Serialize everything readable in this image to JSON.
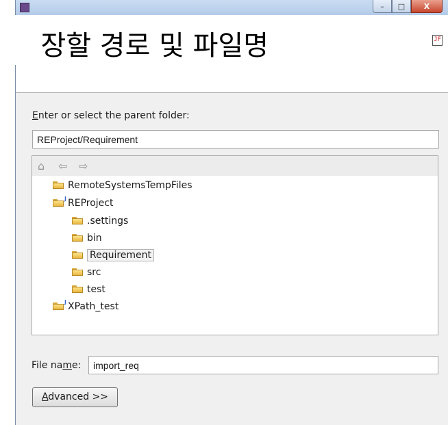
{
  "window": {
    "title": "",
    "controls": {
      "minimize": "–",
      "maximize": "□",
      "close": "X"
    }
  },
  "overlay_title": "장할 경로 및 파일명",
  "parent_folder": {
    "label_first": "E",
    "label_rest": "nter or select the parent folder:",
    "value": "REProject/Requirement"
  },
  "tree": {
    "toolbar_icons": [
      "home-icon",
      "back-arrow-icon",
      "forward-arrow-icon"
    ],
    "nodes": [
      {
        "label": "RemoteSystemsTempFiles",
        "type": "folder",
        "level": 0
      },
      {
        "label": "REProject",
        "type": "project",
        "level": 0
      },
      {
        "label": ".settings",
        "type": "folder",
        "level": 1
      },
      {
        "label": "bin",
        "type": "folder",
        "level": 1
      },
      {
        "label": "Requirement",
        "type": "folder",
        "level": 1,
        "selected": true
      },
      {
        "label": "src",
        "type": "folder",
        "level": 1
      },
      {
        "label": "test",
        "type": "folder",
        "level": 1
      },
      {
        "label": "XPath_test",
        "type": "project",
        "level": 0
      }
    ]
  },
  "file_name": {
    "label_pre": "File na",
    "label_u": "m",
    "label_post": "e:",
    "value": "import_req"
  },
  "advanced_button": {
    "u": "A",
    "rest": "dvanced >>"
  }
}
